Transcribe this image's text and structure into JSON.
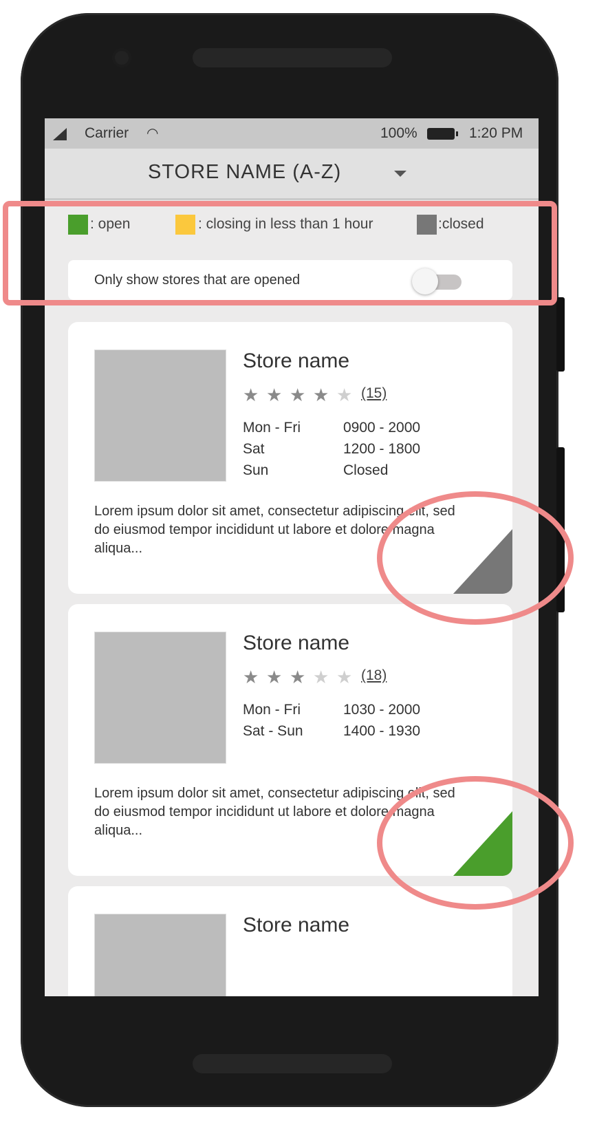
{
  "status_bar": {
    "carrier": "Carrier",
    "battery": "100%",
    "time": "1:20 PM"
  },
  "sort": {
    "label": "STORE NAME (A-Z)"
  },
  "legend": {
    "open": ": open",
    "closing": ": closing in less than 1 hour",
    "closed": ":closed",
    "colors": {
      "open": "#4a9e2c",
      "closing": "#fbc83d",
      "closed": "#777777"
    }
  },
  "filter": {
    "label": "Only show stores that are opened",
    "enabled": false
  },
  "stores": [
    {
      "name": "Store name",
      "rating": 4,
      "reviews": "(15)",
      "hours": [
        {
          "day": "Mon - Fri",
          "time": "0900 - 2000"
        },
        {
          "day": "Sat",
          "time": "1200 - 1800"
        },
        {
          "day": "Sun",
          "time": "Closed"
        }
      ],
      "description": "Lorem ipsum dolor sit amet, consectetur adipiscing elit, sed do eiusmod tempor incididunt ut labore et dolore magna aliqua...",
      "status": "closed",
      "status_color": "#777777"
    },
    {
      "name": "Store name",
      "rating": 3,
      "reviews": "(18)",
      "hours": [
        {
          "day": "Mon - Fri",
          "time": "1030 - 2000"
        },
        {
          "day": "Sat - Sun",
          "time": "1400 - 1930"
        }
      ],
      "description": "Lorem ipsum dolor sit amet, consectetur adipiscing elit, sed do eiusmod tempor incididunt ut labore et dolore magna aliqua...",
      "status": "open",
      "status_color": "#4a9e2c"
    },
    {
      "name": "Store name"
    }
  ]
}
